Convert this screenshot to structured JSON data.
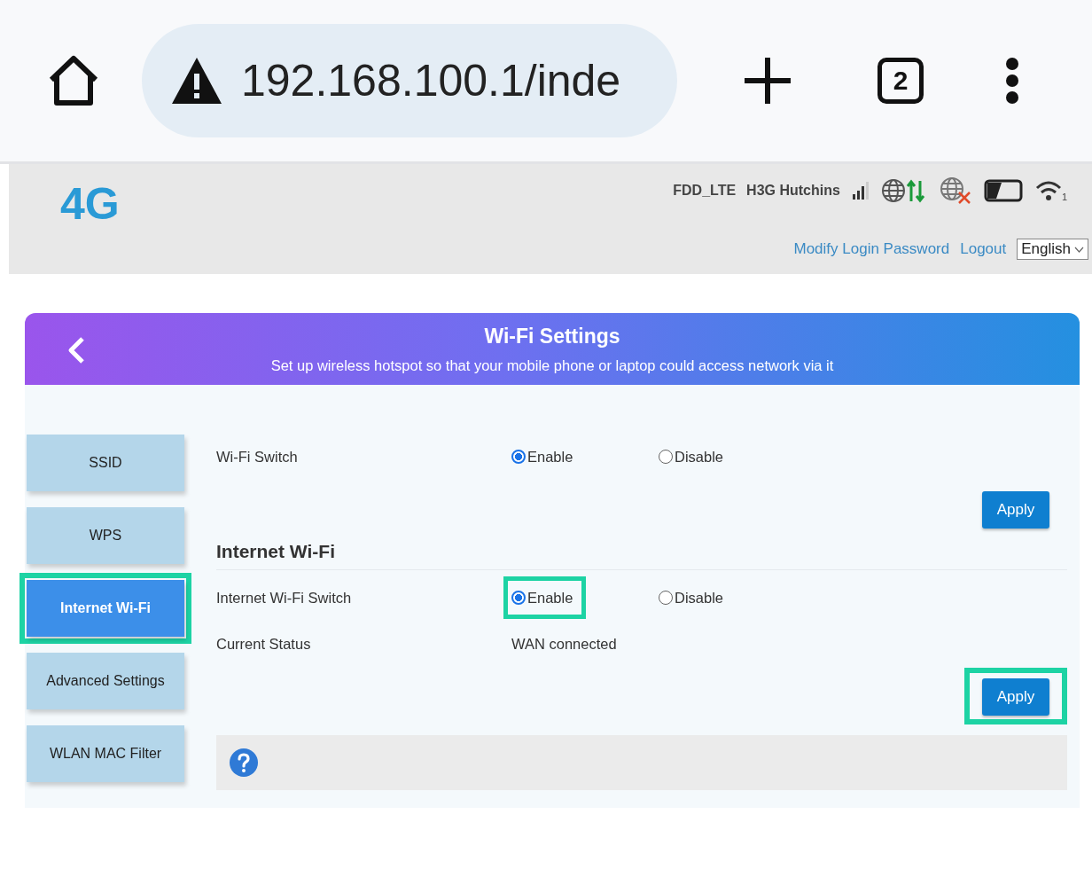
{
  "browser": {
    "url": "192.168.100.1/inde",
    "tab_count": "2"
  },
  "router_header": {
    "logo": "4G",
    "network_type": "FDD_LTE",
    "operator": "H3G Hutchins",
    "wifi_clients": "1",
    "links": [
      "Modify Login Password",
      "Logout"
    ],
    "language": "English"
  },
  "page": {
    "title": "Wi-Fi Settings",
    "subtitle": "Set up wireless hotspot so that your mobile phone or laptop could access network via it"
  },
  "sidebar": {
    "items": [
      {
        "label": "SSID",
        "selected": false,
        "highlighted": false
      },
      {
        "label": "WPS",
        "selected": false,
        "highlighted": false
      },
      {
        "label": "Internet Wi-Fi",
        "selected": true,
        "highlighted": true
      },
      {
        "label": "Advanced Settings",
        "selected": false,
        "highlighted": false
      },
      {
        "label": "WLAN MAC Filter",
        "selected": false,
        "highlighted": false
      }
    ]
  },
  "sections": [
    {
      "switch": {
        "label": "Wi-Fi Switch",
        "options": [
          {
            "label": "Enable",
            "selected": true,
            "highlighted": false
          },
          {
            "label": "Disable",
            "selected": false,
            "highlighted": false
          }
        ]
      },
      "apply": {
        "label": "Apply",
        "highlighted": false
      }
    },
    {
      "heading": "Internet Wi-Fi",
      "switch": {
        "label": "Internet Wi-Fi Switch",
        "options": [
          {
            "label": "Enable",
            "selected": true,
            "highlighted": true
          },
          {
            "label": "Disable",
            "selected": false,
            "highlighted": false
          }
        ]
      },
      "status": {
        "label": "Current Status",
        "value": "WAN connected"
      },
      "apply": {
        "label": "Apply",
        "highlighted": true
      }
    }
  ]
}
